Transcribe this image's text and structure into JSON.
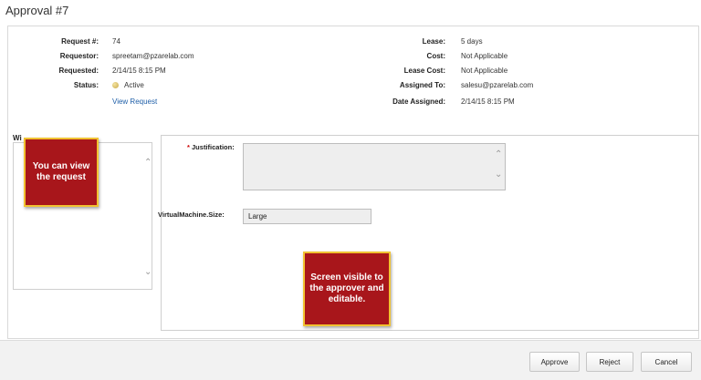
{
  "page": {
    "title": "Approval #7"
  },
  "request": {
    "fields_left": [
      {
        "label": "Request #:",
        "value": "74"
      },
      {
        "label": "Requestor:",
        "value": "spreetam@pzarelab.com"
      },
      {
        "label": "Requested:",
        "value": "2/14/15 8:15 PM"
      },
      {
        "label": "Status:",
        "value": "Active"
      }
    ],
    "view_request_label": "View Request",
    "fields_right": [
      {
        "label": "Lease:",
        "value": "5 days"
      },
      {
        "label": "Cost:",
        "value": "Not Applicable"
      },
      {
        "label": "Lease Cost:",
        "value": "Not Applicable"
      },
      {
        "label": "Assigned To:",
        "value": "salesu@pzarelab.com"
      },
      {
        "label": "Date Assigned:",
        "value": "2/14/15 8:15 PM"
      }
    ]
  },
  "left_section": {
    "label": "Wi"
  },
  "form": {
    "justification_required_mark": "*",
    "justification_label": "Justification:",
    "justification_value": "",
    "vm_size_label": "VirtualMachine.Size:",
    "vm_size_value": "Large"
  },
  "callouts": {
    "view_request": "You can view the request",
    "editable": "Screen visible to the approver and editable."
  },
  "footer": {
    "approve_label": "Approve",
    "reject_label": "Reject",
    "cancel_label": "Cancel"
  },
  "colors": {
    "callout_fill": "#a8161b",
    "callout_border": "#f1c232",
    "link": "#1f5fa8"
  }
}
